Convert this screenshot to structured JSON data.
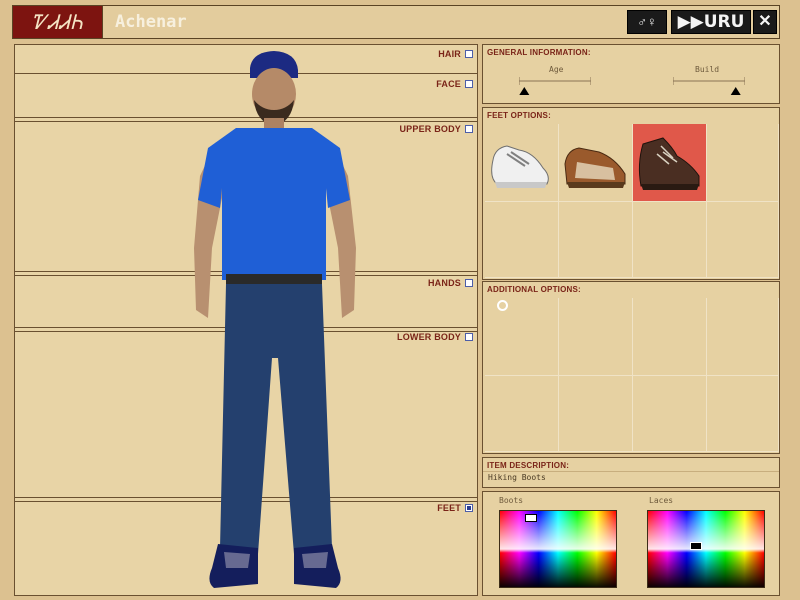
{
  "title": {
    "logo": "ᏤᏗᏗᏂ",
    "avatar_name": "Achenar"
  },
  "toolbar": {
    "gender_icon": "male-female-icon",
    "uru_label": "URU",
    "close_label": "✕"
  },
  "body_sections": [
    {
      "label": "HAIR",
      "checked": false
    },
    {
      "label": "FACE",
      "checked": false
    },
    {
      "label": "UPPER BODY",
      "checked": false
    },
    {
      "label": "HANDS",
      "checked": false
    },
    {
      "label": "LOWER BODY",
      "checked": false
    },
    {
      "label": "FEET",
      "checked": true
    }
  ],
  "general_info": {
    "header": "GENERAL INFORMATION:",
    "age_label": "Age",
    "build_label": "Build",
    "age_value": 0.05,
    "build_value": 0.92
  },
  "feet_options": {
    "header": "FEET OPTIONS:",
    "items": [
      "white-sneaker",
      "brown-sandal",
      "hiking-boot"
    ],
    "selected_index": 2
  },
  "additional_options": {
    "header": "ADDITIONAL OPTIONS:"
  },
  "item_description": {
    "header": "ITEM DESCRIPTION:",
    "text": "Hiking Boots"
  },
  "colors": {
    "boots_label": "Boots",
    "laces_label": "Laces"
  }
}
